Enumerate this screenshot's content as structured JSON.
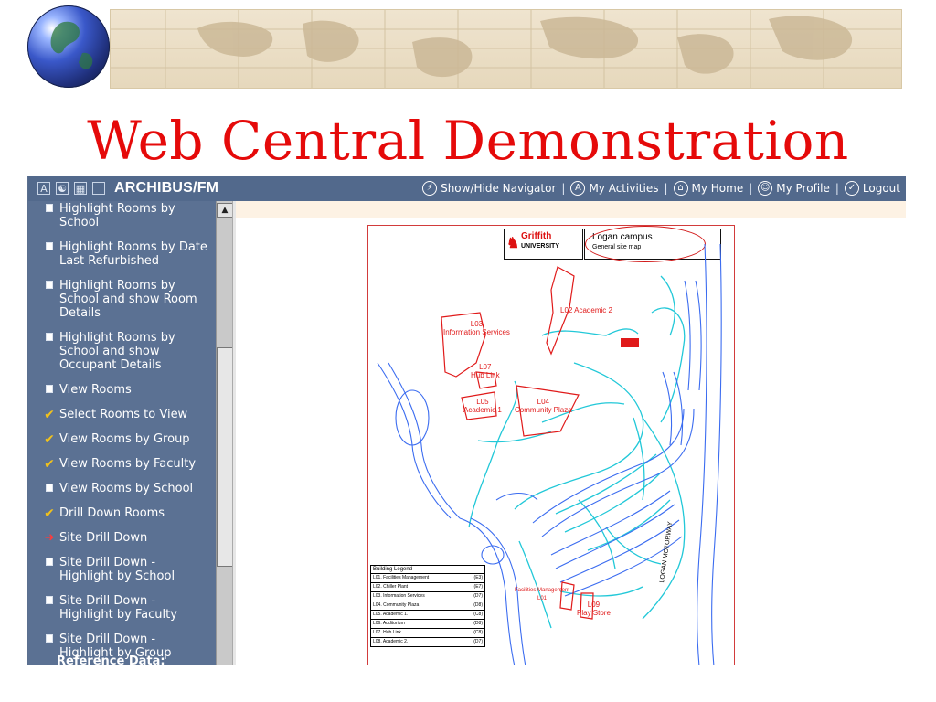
{
  "slide": {
    "title": "Web Central Demonstration"
  },
  "app": {
    "brand": "ARCHIBUS/FM",
    "brand_icons": [
      "a-logo-icon",
      "binoculars-icon",
      "grid-icon",
      "square-icon"
    ],
    "nav": [
      {
        "label": "Show/Hide Navigator",
        "icon": "lightning-icon"
      },
      {
        "label": "My Activities",
        "icon": "a-circle-icon"
      },
      {
        "label": "My Home",
        "icon": "home-icon"
      },
      {
        "label": "My Profile",
        "icon": "profile-icon"
      },
      {
        "label": "Logout",
        "icon": "check-circle-icon"
      }
    ]
  },
  "sidebar": {
    "items": [
      {
        "label": "Highlight Rooms by School",
        "icon": "doc-icon"
      },
      {
        "label": "Highlight Rooms by Date Last Refurbished",
        "icon": "doc-icon"
      },
      {
        "label": "Highlight Rooms by School and show Room Details",
        "icon": "doc-icon"
      },
      {
        "label": "Highlight Rooms by School and show Occupant Details",
        "icon": "doc-icon"
      },
      {
        "label": "View Rooms",
        "icon": "doc-icon"
      },
      {
        "label": "Select Rooms to View",
        "icon": "check-icon"
      },
      {
        "label": "View Rooms by Group",
        "icon": "check-icon"
      },
      {
        "label": "View Rooms by Faculty",
        "icon": "check-icon"
      },
      {
        "label": "View Rooms by School",
        "icon": "doc-icon"
      },
      {
        "label": "Drill Down Rooms",
        "icon": "check-icon"
      },
      {
        "label": "Site Drill Down",
        "icon": "arrow-icon"
      },
      {
        "label": "Site Drill Down - Highlight by School",
        "icon": "doc-icon"
      },
      {
        "label": "Site Drill Down - Highlight by Faculty",
        "icon": "doc-icon"
      },
      {
        "label": "Site Drill Down - Highlight by Group",
        "icon": "doc-icon"
      }
    ],
    "cut_off_label": "Reference Data:",
    "colors": {
      "background": "#5b7193",
      "check": "#f2c21b",
      "arrow": "#ff3b3b"
    }
  },
  "map": {
    "logo_name": "Griffith",
    "logo_sub": "UNIVERSITY",
    "campus_title": "Logan campus",
    "campus_sub": "General site map",
    "buildings": [
      {
        "code": "L02",
        "label": "L02\nAcademic 2"
      },
      {
        "code": "L03",
        "label": "L03\nInformation Services"
      },
      {
        "code": "L07",
        "label": "L07\nHub Link"
      },
      {
        "code": "L05",
        "label": "L05\nAcademic 1"
      },
      {
        "code": "L04",
        "label": "L04\nCommunity Plaza"
      },
      {
        "code": "L01",
        "label": "Facilities Management\nL01"
      },
      {
        "code": "L09",
        "label": "L09\nPlay Store"
      }
    ],
    "road_label": "LOGAN MOTORWAY",
    "legend": {
      "title": "Building Legend",
      "rows": [
        {
          "name": "L01. Facilities Management",
          "ref": "(E3)"
        },
        {
          "name": "L02. Chiller Plant",
          "ref": "(E7)"
        },
        {
          "name": "L03. Information Services",
          "ref": "(D7)"
        },
        {
          "name": "L04. Community Plaza",
          "ref": "(D8)"
        },
        {
          "name": "L05. Academic 1.",
          "ref": "(C8)"
        },
        {
          "name": "L06. Auditorium",
          "ref": "(D8)"
        },
        {
          "name": "L07. Hub Link",
          "ref": "(C8)"
        },
        {
          "name": "L08. Academic 2.",
          "ref": "(D7)"
        }
      ]
    },
    "colors": {
      "building": "#e01a1a",
      "path": "#22c8d8",
      "road": "#3b6cf0"
    }
  }
}
